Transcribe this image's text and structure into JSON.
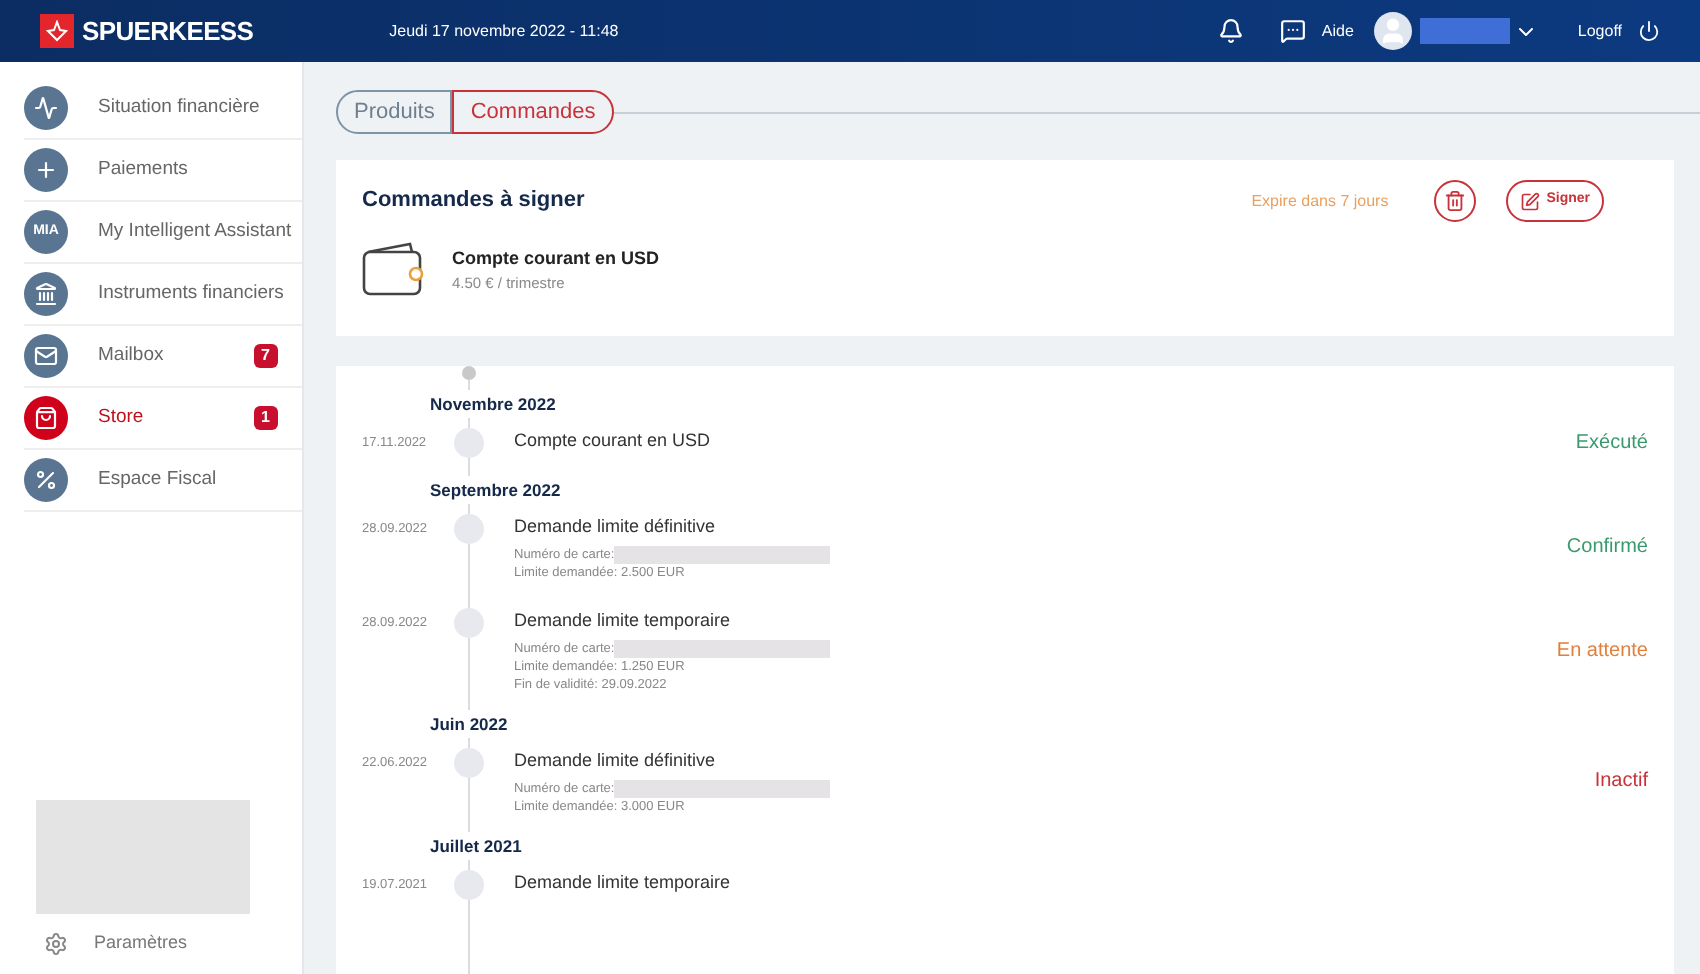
{
  "header": {
    "brand": "SPUERKEESS",
    "datetime": "Jeudi 17 novembre 2022 - 11:48",
    "help": "Aide",
    "logoff": "Logoff"
  },
  "sidebar": {
    "items": [
      {
        "label": "Situation financière",
        "selected": false
      },
      {
        "label": "Paiements",
        "selected": false
      },
      {
        "label": "My Intelligent Assistant",
        "icon_text": "MIA",
        "selected": false
      },
      {
        "label": "Instruments financiers",
        "selected": false
      },
      {
        "label": "Mailbox",
        "badge": "7",
        "selected": false
      },
      {
        "label": "Store",
        "badge": "1",
        "selected": true
      },
      {
        "label": "Espace Fiscal",
        "selected": false
      }
    ],
    "settings": "Paramètres"
  },
  "tabs": [
    {
      "label": "Produits",
      "selected": false
    },
    {
      "label": "Commandes",
      "selected": true
    }
  ],
  "pending": {
    "title": "Commandes à signer",
    "expiry": "Expire dans 7 jours",
    "sign": "Signer",
    "product": "Compte courant en USD",
    "price": "4.50 € / trimestre"
  },
  "timeline": [
    {
      "month": "Novembre 2022",
      "entries": [
        {
          "date": "17.11.2022",
          "title": "Compte courant en USD",
          "status": "Exécuté",
          "kind": "done"
        }
      ]
    },
    {
      "month": "Septembre 2022",
      "entries": [
        {
          "date": "28.09.2022",
          "title": "Demande limite définitive",
          "status": "Confirmé",
          "kind": "done",
          "details": [
            {
              "kind": "redacted",
              "text": "Numéro de carte:"
            },
            {
              "kind": "text",
              "text": "Limite demandée: 2.500 EUR"
            }
          ]
        },
        {
          "date": "28.09.2022",
          "title": "Demande limite temporaire",
          "status": "En attente",
          "kind": "pending",
          "details": [
            {
              "kind": "redacted",
              "text": "Numéro de carte:"
            },
            {
              "kind": "text",
              "text": "Limite demandée: 1.250 EUR"
            },
            {
              "kind": "text",
              "text": "Fin de validité: 29.09.2022"
            }
          ]
        }
      ]
    },
    {
      "month": "Juin 2022",
      "entries": [
        {
          "date": "22.06.2022",
          "title": "Demande limite définitive",
          "status": "Inactif",
          "kind": "inactive",
          "details": [
            {
              "kind": "redacted",
              "text": "Numéro de carte:"
            },
            {
              "kind": "text",
              "text": "Limite demandée: 3.000 EUR"
            }
          ]
        }
      ]
    },
    {
      "month": "Juillet 2021",
      "entries": [
        {
          "date": "19.07.2021",
          "title": "Demande limite temporaire"
        }
      ]
    }
  ]
}
